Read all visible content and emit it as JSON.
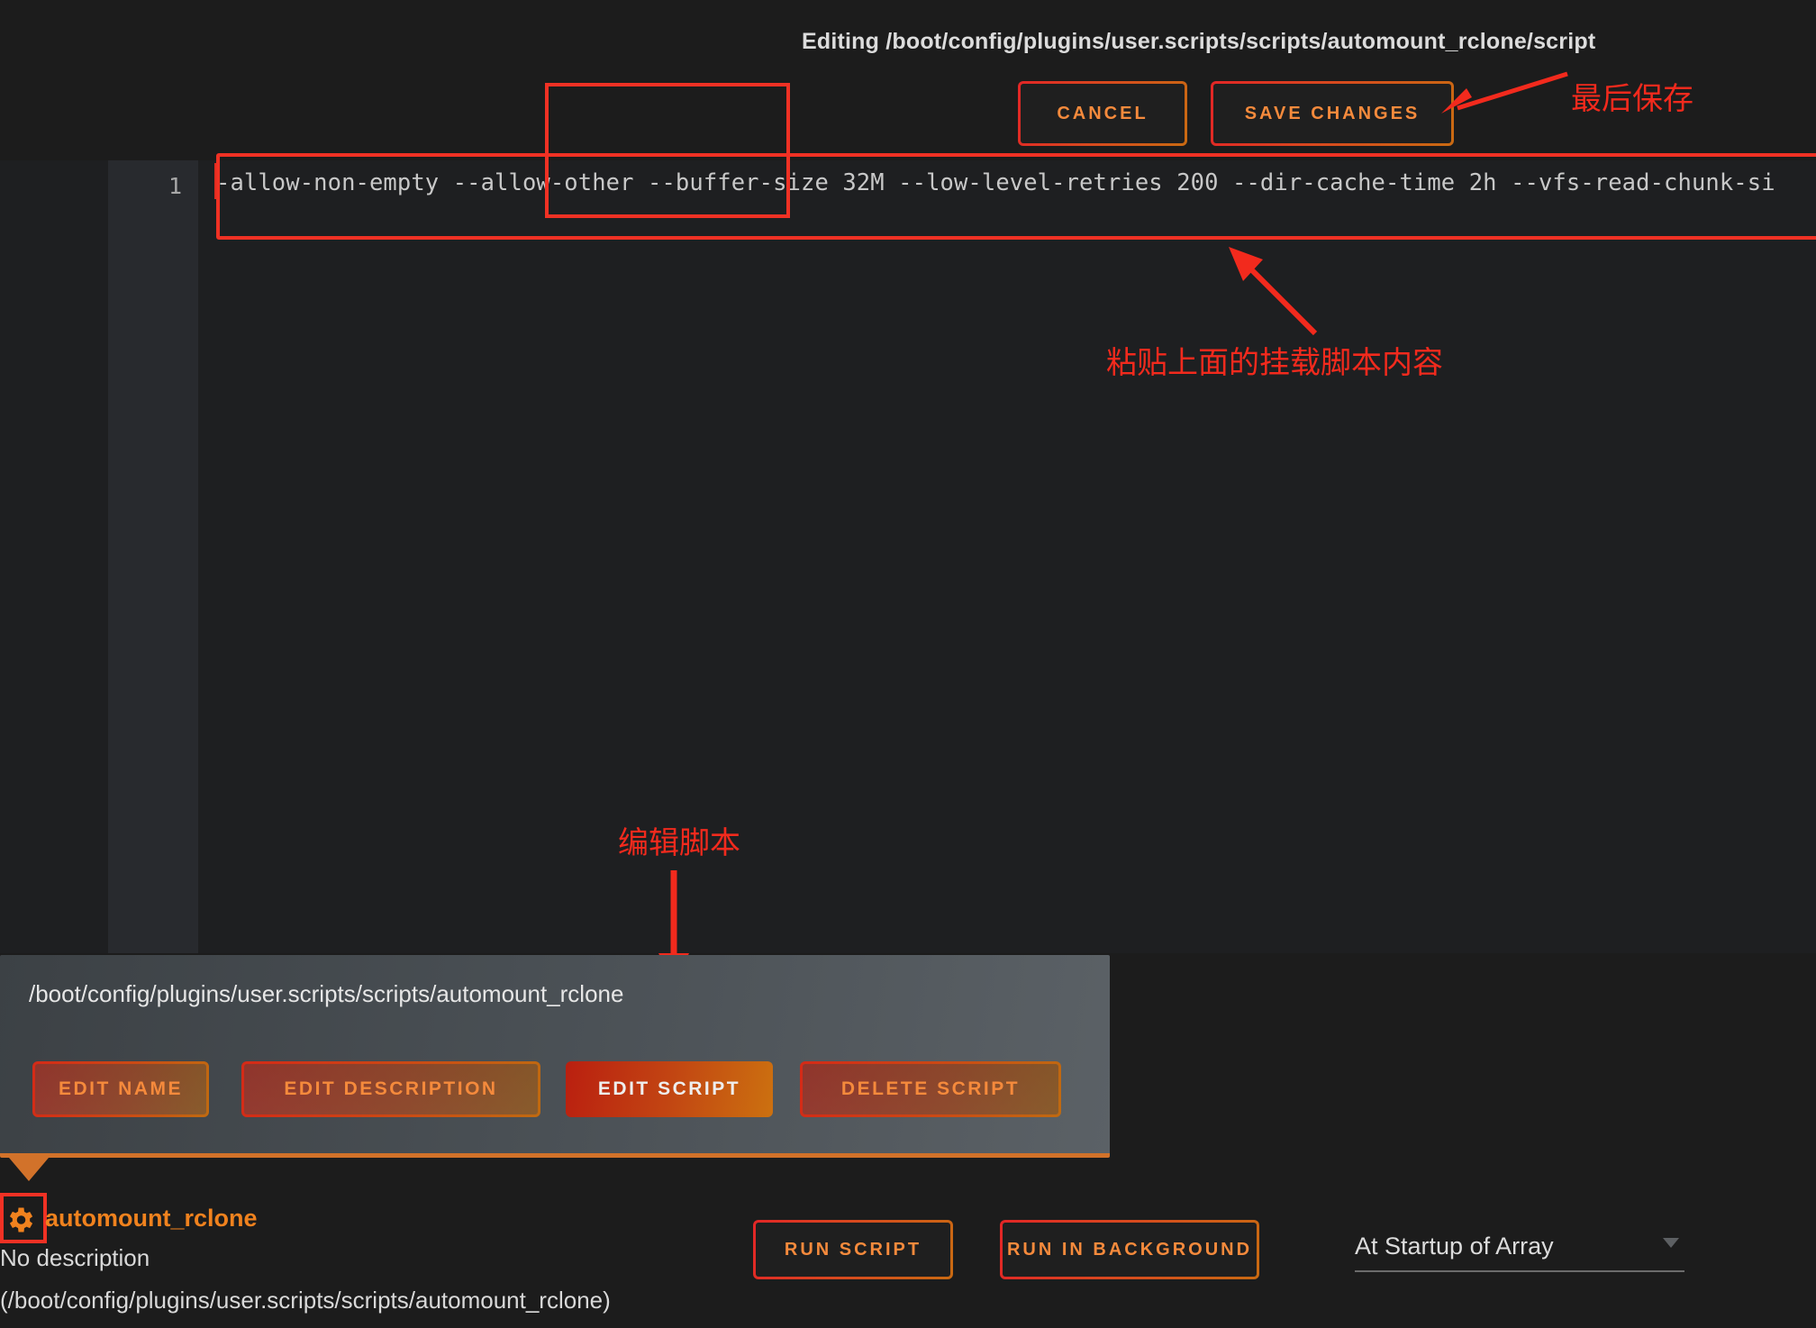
{
  "header": {
    "editing_title": "Editing /boot/config/plugins/user.scripts/scripts/automount_rclone/script",
    "cancel_label": "CANCEL",
    "save_label": "SAVE CHANGES"
  },
  "editor": {
    "line_number": "1",
    "code": "-allow-non-empty --allow-other --buffer-size 32M --low-level-retries 200 --dir-cache-time 2h --vfs-read-chunk-si"
  },
  "annotations": {
    "save_note": "最后保存",
    "paste_note": "粘贴上面的挂载脚本内容",
    "edit_note": "编辑脚本"
  },
  "popup": {
    "path": "/boot/config/plugins/user.scripts/scripts/automount_rclone",
    "buttons": {
      "edit_name": "EDIT NAME",
      "edit_description": "EDIT DESCRIPTION",
      "edit_script": "EDIT SCRIPT",
      "delete_script": "DELETE SCRIPT"
    }
  },
  "bottom": {
    "script_name": "automount_rclone",
    "description": "No description",
    "script_path": "(/boot/config/plugins/user.scripts/scripts/automount_rclone)",
    "run_script_label": "RUN SCRIPT",
    "run_background_label": "RUN IN BACKGROUND",
    "schedule_value": "At Startup of Array"
  },
  "colors": {
    "accent_orange": "#f0821e",
    "accent_red": "#d42a17",
    "annotation_red": "#f22a1d",
    "background": "#1c1c1c"
  }
}
